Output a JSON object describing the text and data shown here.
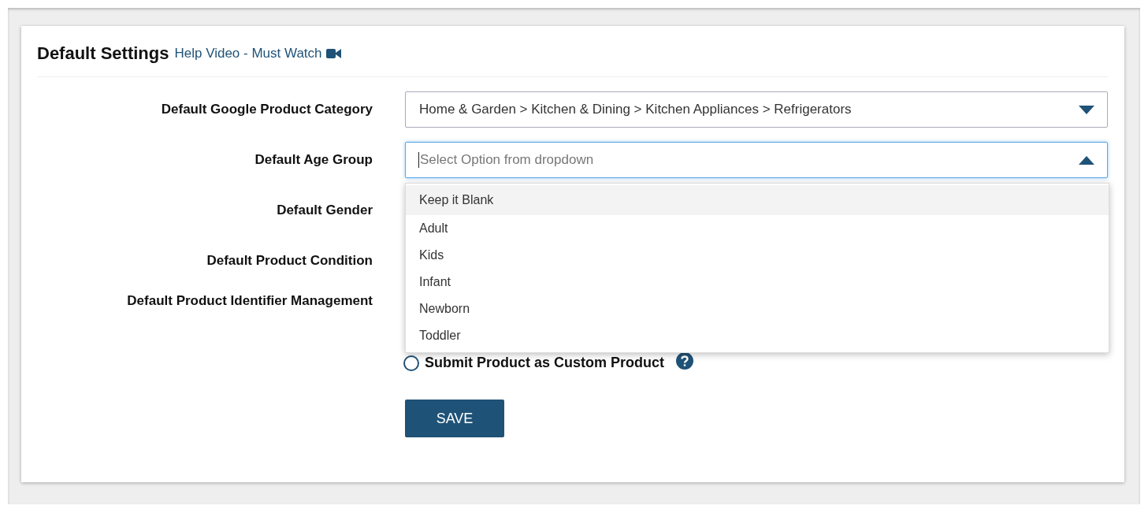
{
  "header": {
    "title": "Default Settings",
    "help_link": "Help Video - Must Watch"
  },
  "fields": [
    {
      "label": "Default Google Product Category",
      "kind": "select",
      "value": "Home & Garden > Kitchen & Dining > Kitchen Appliances > Refrigerators",
      "expanded": false
    },
    {
      "label": "Default Age Group",
      "kind": "select",
      "placeholder": "Select Option from dropdown",
      "expanded": true,
      "options": [
        {
          "label": "Keep it Blank",
          "selected": true
        },
        {
          "label": "Adult",
          "selected": false
        },
        {
          "label": "Kids",
          "selected": false
        },
        {
          "label": "Infant",
          "selected": false
        },
        {
          "label": "Newborn",
          "selected": false
        },
        {
          "label": "Toddler",
          "selected": false
        }
      ]
    },
    {
      "label": "Default Gender",
      "kind": "covered"
    },
    {
      "label": "Default Product Condition",
      "kind": "covered"
    },
    {
      "label": "Default Product Identifier Management",
      "kind": "radio",
      "radio": {
        "label": "Submit Product as Custom Product",
        "checked": false
      }
    }
  ],
  "save_button": "SAVE"
}
